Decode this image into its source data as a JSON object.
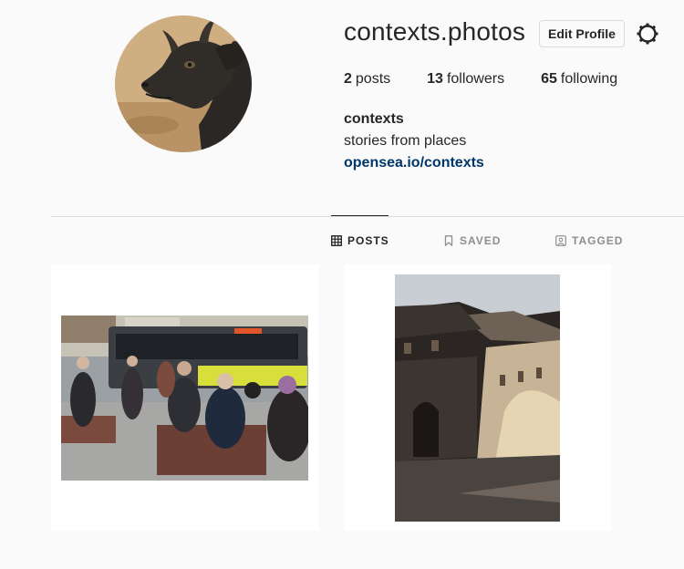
{
  "profile": {
    "username": "contexts.photos",
    "edit_label": "Edit Profile",
    "full_name": "contexts",
    "bio": "stories from places",
    "link": "opensea.io/contexts",
    "stats": [
      {
        "count": "2",
        "label": "posts"
      },
      {
        "count": "13",
        "label": "followers"
      },
      {
        "count": "65",
        "label": "following"
      }
    ]
  },
  "tabs": [
    {
      "label": "POSTS",
      "icon": "grid-icon",
      "active": true
    },
    {
      "label": "SAVED",
      "icon": "bookmark-icon",
      "active": false
    },
    {
      "label": "TAGGED",
      "icon": "tag-user-icon",
      "active": false
    }
  ],
  "posts": [
    {
      "subject": "street scene with bus and seated people"
    },
    {
      "subject": "courtyard with stone building at sunset"
    }
  ],
  "colors": {
    "background": "#fafafa",
    "text": "#262626",
    "muted": "#8e8e8e",
    "link": "#00376b",
    "border": "#dbdbdb"
  }
}
